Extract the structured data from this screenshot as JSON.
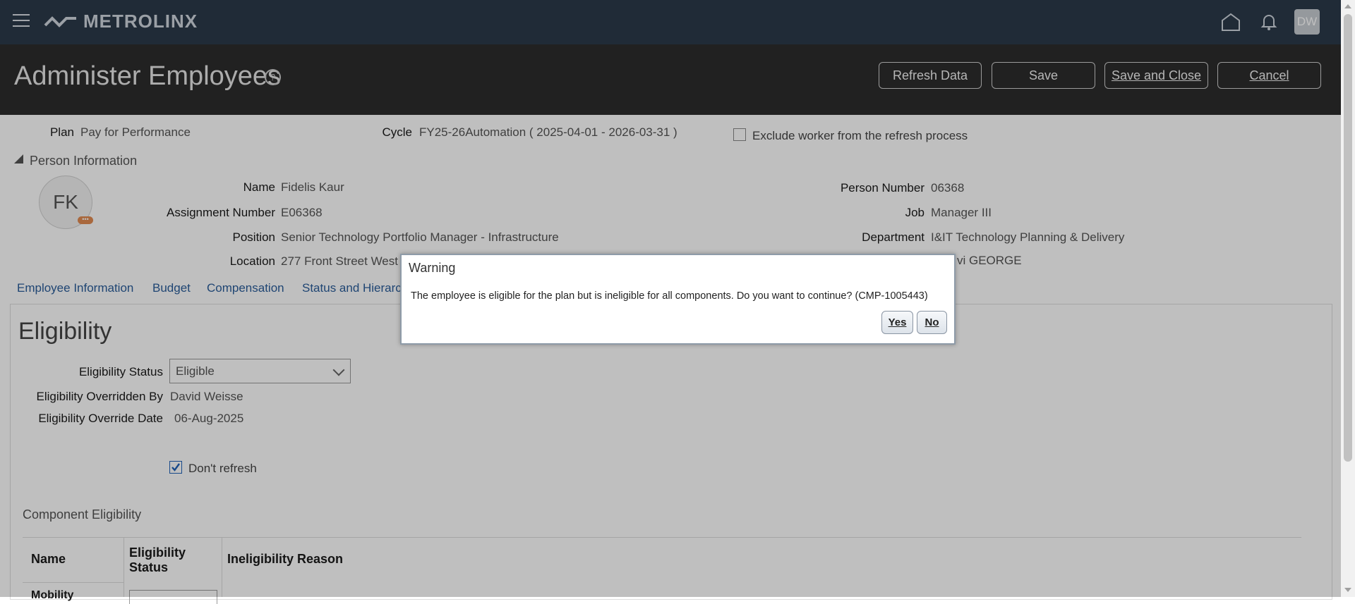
{
  "app": {
    "brand": "METROLINX",
    "user_initials": "DW"
  },
  "header": {
    "title": "Administer Employees",
    "help_glyph": "?",
    "buttons": {
      "refresh": "Refresh Data",
      "save": "Save",
      "save_close": "Save and Close",
      "cancel": "Cancel"
    }
  },
  "summary": {
    "plan_label": "Plan",
    "plan_value": "Pay for Performance",
    "cycle_label": "Cycle",
    "cycle_value": "FY25-26Automation ( 2025-04-01 - 2026-03-31 )",
    "exclude_label": "Exclude worker from the refresh process"
  },
  "person": {
    "section_title": "Person Information",
    "initials": "FK",
    "fields": {
      "name_label": "Name",
      "name_value": "Fidelis Kaur",
      "assignment_label": "Assignment Number",
      "assignment_value": "E06368",
      "position_label": "Position",
      "position_value": "Senior Technology Portfolio Manager - Infrastructure",
      "location_label": "Location",
      "location_value": "277 Front Street West",
      "person_number_label": "Person Number",
      "person_number_value": "06368",
      "job_label": "Job",
      "job_value": "Manager III",
      "department_label": "Department",
      "department_value": "I&IT Technology Planning & Delivery",
      "manager_value_partial": "vi GEORGE"
    }
  },
  "tabs": [
    "Employee Information",
    "Budget",
    "Compensation",
    "Status and Hierarc"
  ],
  "eligibility": {
    "heading": "Eligibility",
    "status_label": "Eligibility Status",
    "status_value": "Eligible",
    "overridden_by_label": "Eligibility Overridden By",
    "overridden_by_value": "David Weisse",
    "override_date_label": "Eligibility Override Date",
    "override_date_value": "06-Aug-2025",
    "dont_refresh_label": "Don't refresh",
    "dont_refresh_checked": true
  },
  "component_eligibility": {
    "heading": "Component Eligibility",
    "columns": [
      "Name",
      "Eligibility Status",
      "Ineligibility Reason"
    ],
    "first_row_partial": "Mobility"
  },
  "dialog": {
    "title": "Warning",
    "message": "The employee is eligible for the plan but is ineligible for all components. Do you want to continue? (CMP-1005443)",
    "yes": "Yes",
    "no": "No"
  },
  "colors": {
    "topbar": "#2b3a4a",
    "titlebar": "#2d2d2d",
    "link": "#2a5d9a",
    "badge": "#e28b52"
  }
}
